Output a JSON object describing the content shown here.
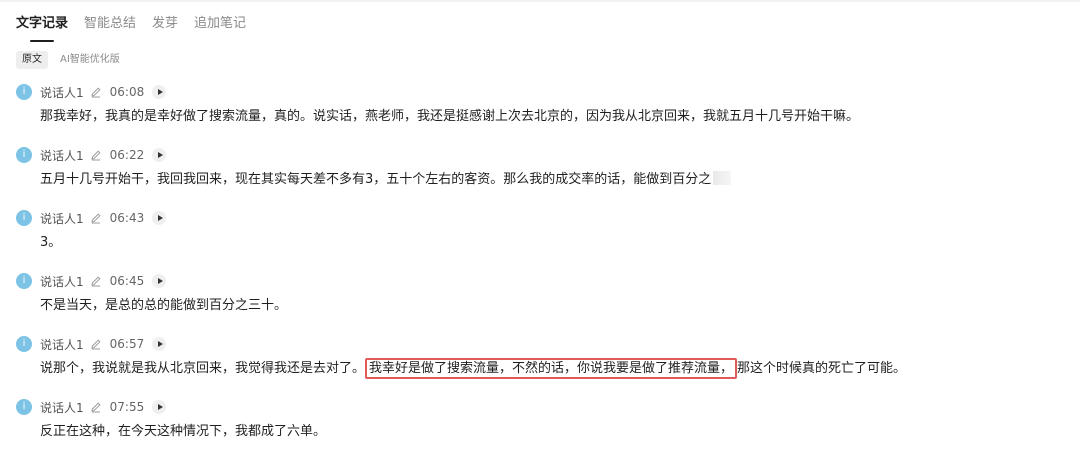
{
  "tabs": [
    "文字记录",
    "智能总结",
    "发芽",
    "追加笔记"
  ],
  "modes": [
    "原文",
    "AI智能优化版"
  ],
  "avatar_letter": "i",
  "entries": [
    {
      "speaker": "说话人1",
      "time": "06:08",
      "text": "那我幸好，我真的是幸好做了搜索流量，真的。说实话，燕老师，我还是挺感谢上次去北京的，因为我从北京回来，我就五月十几号开始干嘛。"
    },
    {
      "speaker": "说话人1",
      "time": "06:22",
      "text": "五月十几号开始干，我回我回来，现在其实每天差不多有3，五十个左右的客资。那么我的成交率的话，能做到百分之"
    },
    {
      "speaker": "说话人1",
      "time": "06:43",
      "text": "3。"
    },
    {
      "speaker": "说话人1",
      "time": "06:45",
      "text": "不是当天，是总的总的能做到百分之三十。"
    },
    {
      "speaker": "说话人1",
      "time": "06:57",
      "text_before": "说那个，我说就是我从北京回来，我觉得我还是去对了。",
      "text_highlight": "我幸好是做了搜索流量，不然的话，你说我要是做了推荐流量，",
      "text_after": "那这个时候真的死亡了可能。"
    },
    {
      "speaker": "说话人1",
      "time": "07:55",
      "text": "反正在这种，在今天这种情况下，我都成了六单。"
    }
  ]
}
